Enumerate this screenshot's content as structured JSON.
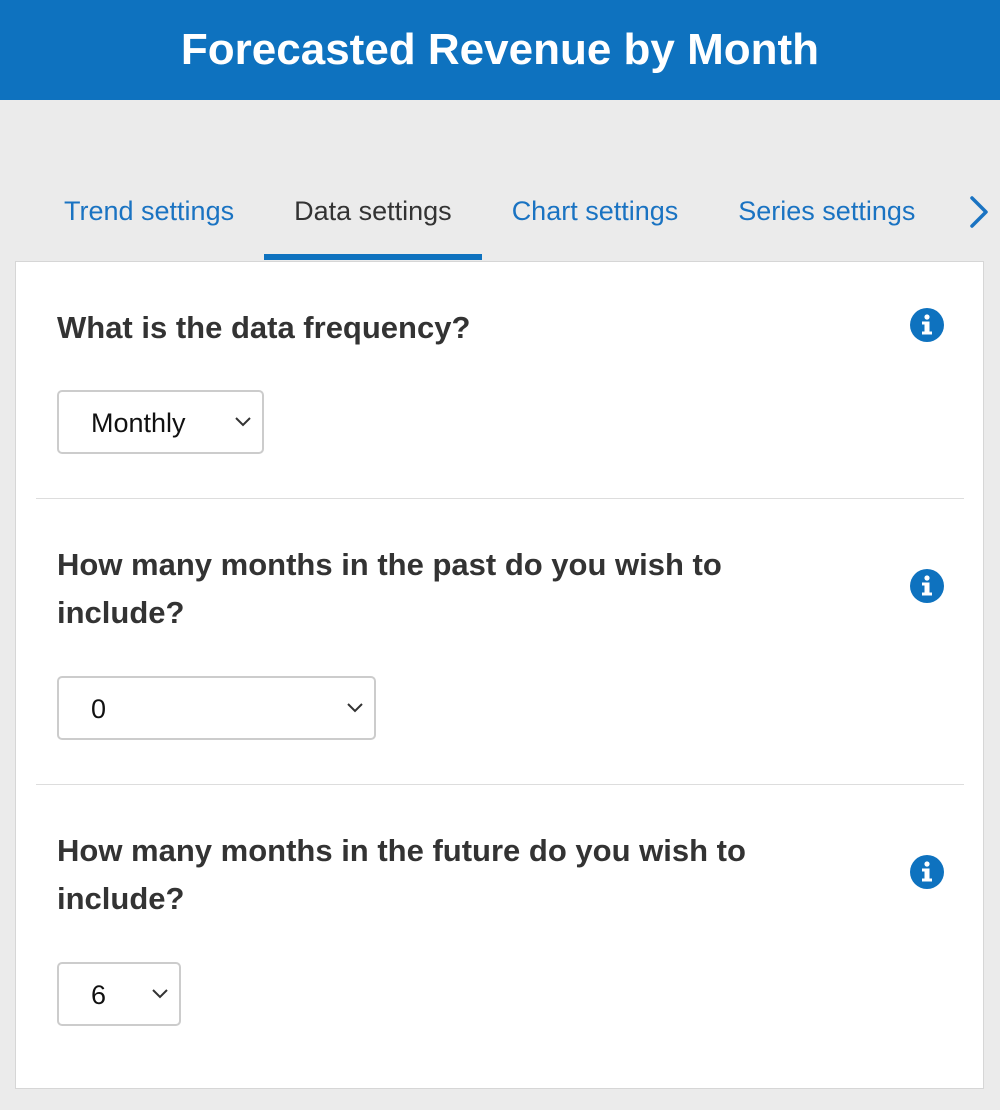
{
  "header": {
    "title": "Forecasted Revenue by Month"
  },
  "tabs": [
    {
      "label": "Trend settings",
      "active": false
    },
    {
      "label": "Data settings",
      "active": true
    },
    {
      "label": "Chart settings",
      "active": false
    },
    {
      "label": "Series settings",
      "active": false
    }
  ],
  "colors": {
    "accent": "#0e72bf",
    "link": "#1a73c2",
    "text": "#333333",
    "background": "#ebebeb"
  },
  "icons": {
    "next_tab": "chevron-right-icon",
    "info": "info-icon",
    "dropdown": "chevron-down-icon"
  },
  "sections": [
    {
      "question": "What is the data frequency?",
      "value": "Monthly"
    },
    {
      "question": "How many months in the past do you wish to include?",
      "value": "0"
    },
    {
      "question": "How many months in the future do you wish to include?",
      "value": "6"
    }
  ]
}
